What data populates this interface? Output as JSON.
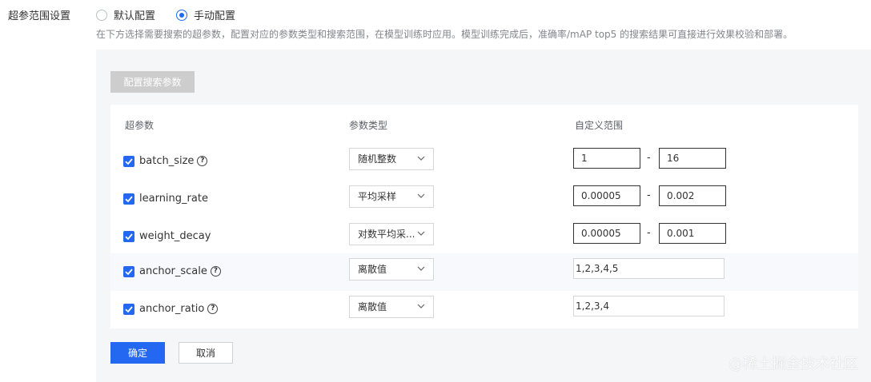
{
  "field": {
    "label": "超参范围设置",
    "options": [
      {
        "label": "默认配置",
        "checked": false
      },
      {
        "label": "手动配置",
        "checked": true
      }
    ],
    "description": "在下方选择需要搜索的超参数，配置对应的参数类型和搜索范围，在模型训练时应用。模型训练完成后，准确率/mAP top5 的搜索结果可直接进行效果校验和部署。"
  },
  "config_button": "配置搜索参数",
  "table": {
    "headers": [
      "超参数",
      "参数类型",
      "自定义范围"
    ],
    "rows": [
      {
        "name": "batch_size",
        "help": true,
        "type": "随机整数",
        "min": "1",
        "max": "16",
        "checked": true
      },
      {
        "name": "learning_rate",
        "help": false,
        "type": "平均采样",
        "min": "0.00005",
        "max": "0.002",
        "checked": true
      },
      {
        "name": "weight_decay",
        "help": false,
        "type": "对数平均采...",
        "min": "0.00005",
        "max": "0.001",
        "checked": true
      },
      {
        "name": "anchor_scale",
        "help": true,
        "type": "离散值",
        "value": "1,2,3,4,5",
        "checked": true
      },
      {
        "name": "anchor_ratio",
        "help": true,
        "type": "离散值",
        "value": "1,2,3,4",
        "checked": true
      }
    ],
    "range_separator": "-"
  },
  "actions": {
    "confirm": "确定",
    "cancel": "取消"
  },
  "watermark": "@稀土掘金技术社区",
  "colors": {
    "accent": "#2468f2",
    "panel": "#f5f6f8",
    "disabled_button": "#cdcdcd"
  }
}
